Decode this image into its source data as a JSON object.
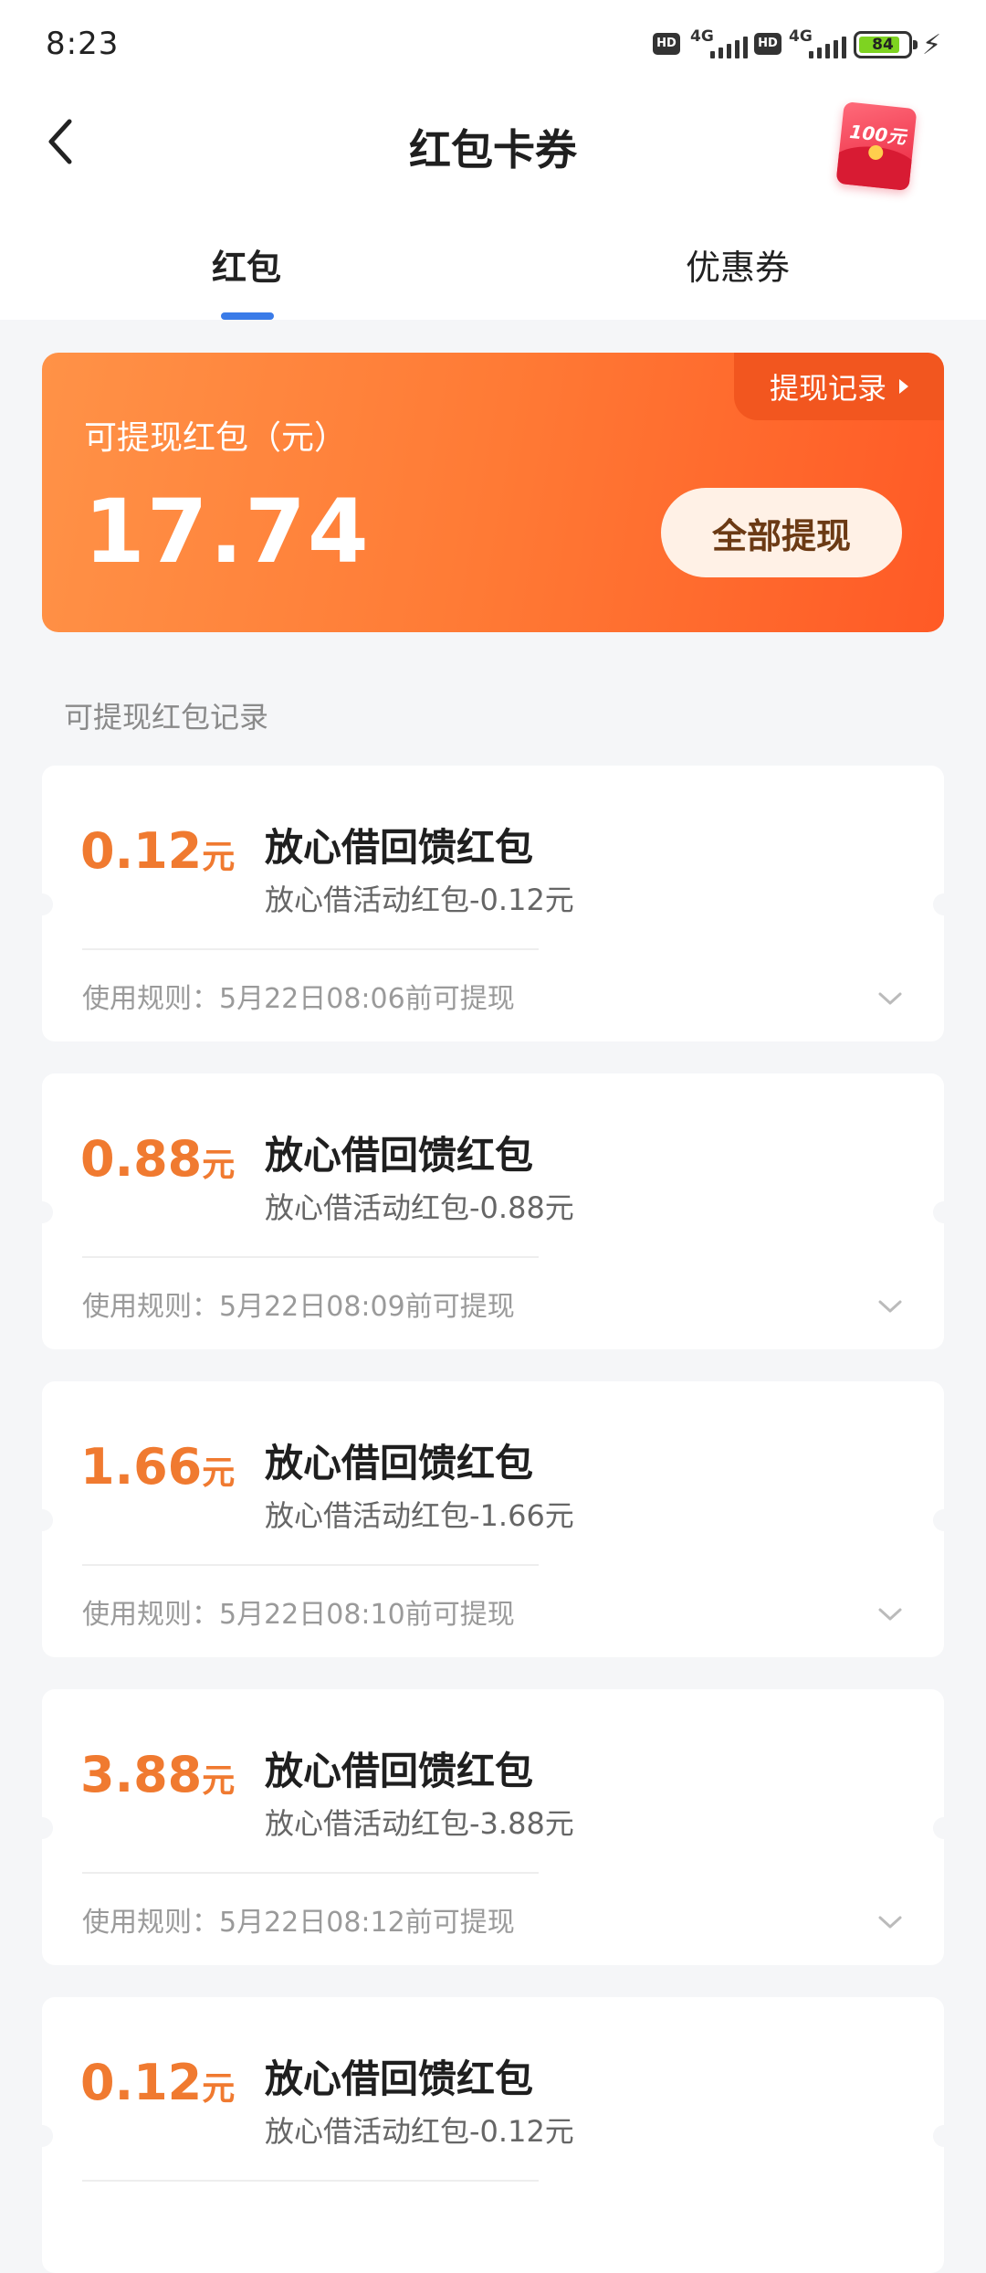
{
  "status_bar": {
    "time": "8:23",
    "hd_label": "HD",
    "network_label": "4G",
    "battery_level": "84"
  },
  "header": {
    "title": "红包卡券",
    "promo_badge_text": "100元"
  },
  "tabs": [
    {
      "label": "红包",
      "active": true
    },
    {
      "label": "优惠券",
      "active": false
    }
  ],
  "balance_card": {
    "label": "可提现红包（元）",
    "amount": "17.74",
    "records_link": "提现记录",
    "withdraw_button": "全部提现"
  },
  "records_section_title": "可提现红包记录",
  "records": [
    {
      "amount": "0.12",
      "unit": "元",
      "title": "放心借回馈红包",
      "desc": "放心借活动红包-0.12元",
      "rule": "使用规则：5月22日08:06前可提现"
    },
    {
      "amount": "0.88",
      "unit": "元",
      "title": "放心借回馈红包",
      "desc": "放心借活动红包-0.88元",
      "rule": "使用规则：5月22日08:09前可提现"
    },
    {
      "amount": "1.66",
      "unit": "元",
      "title": "放心借回馈红包",
      "desc": "放心借活动红包-1.66元",
      "rule": "使用规则：5月22日08:10前可提现"
    },
    {
      "amount": "3.88",
      "unit": "元",
      "title": "放心借回馈红包",
      "desc": "放心借活动红包-3.88元",
      "rule": "使用规则：5月22日08:12前可提现"
    },
    {
      "amount": "0.12",
      "unit": "元",
      "title": "放心借回馈红包",
      "desc": "放心借活动红包-0.12元",
      "rule": ""
    }
  ],
  "colors": {
    "accent_orange": "#f07a30",
    "tab_indicator": "#3a7be8",
    "card_gradient_start": "#ff9247",
    "card_gradient_end": "#ff5a26"
  }
}
